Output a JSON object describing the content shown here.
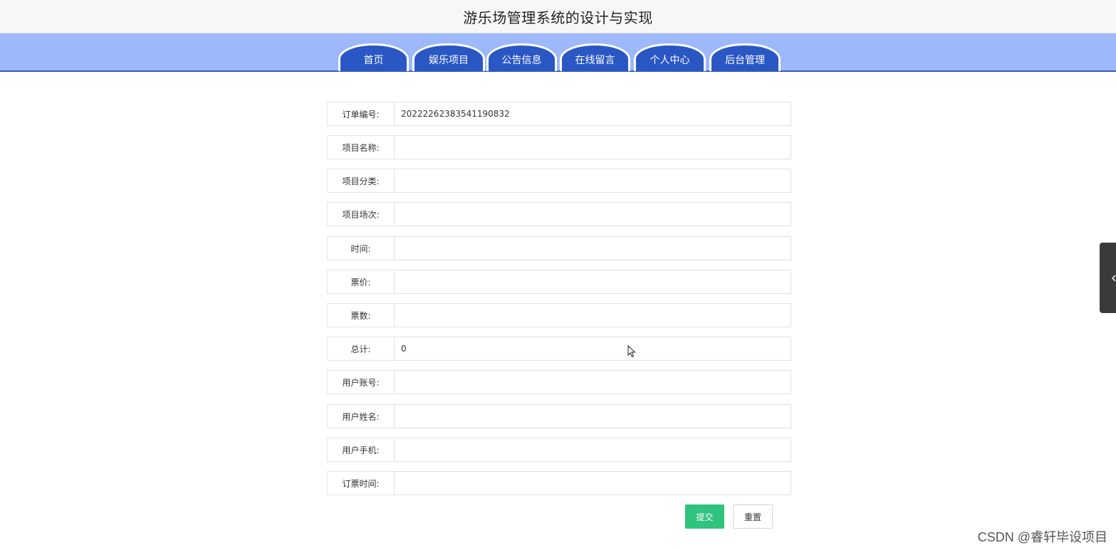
{
  "header": {
    "title": "游乐场管理系统的设计与实现"
  },
  "nav": {
    "items": [
      {
        "label": "首页"
      },
      {
        "label": "娱乐项目"
      },
      {
        "label": "公告信息"
      },
      {
        "label": "在线留言"
      },
      {
        "label": "个人中心"
      },
      {
        "label": "后台管理"
      }
    ]
  },
  "form": {
    "fields": [
      {
        "label": "订单编号:",
        "value": "20222262383541190832"
      },
      {
        "label": "项目名称:",
        "value": ""
      },
      {
        "label": "项目分类:",
        "value": ""
      },
      {
        "label": "项目场次:",
        "value": ""
      },
      {
        "label": "时间:",
        "value": ""
      },
      {
        "label": "票价:",
        "value": ""
      },
      {
        "label": "票数:",
        "value": ""
      },
      {
        "label": "总计:",
        "value": "0"
      },
      {
        "label": "用户账号:",
        "value": ""
      },
      {
        "label": "用户姓名:",
        "value": ""
      },
      {
        "label": "用户手机:",
        "value": ""
      },
      {
        "label": "订票时间:",
        "value": ""
      }
    ],
    "submit_label": "提交",
    "reset_label": "重置"
  },
  "watermark": "CSDN @睿轩毕设项目",
  "colors": {
    "nav_bar": "#9db8fb",
    "nav_tab": "#2a57c3",
    "submit": "#2fc37e"
  },
  "icons": {
    "side_tab": "chevron-left-icon",
    "cursor": "mouse-cursor-icon"
  }
}
